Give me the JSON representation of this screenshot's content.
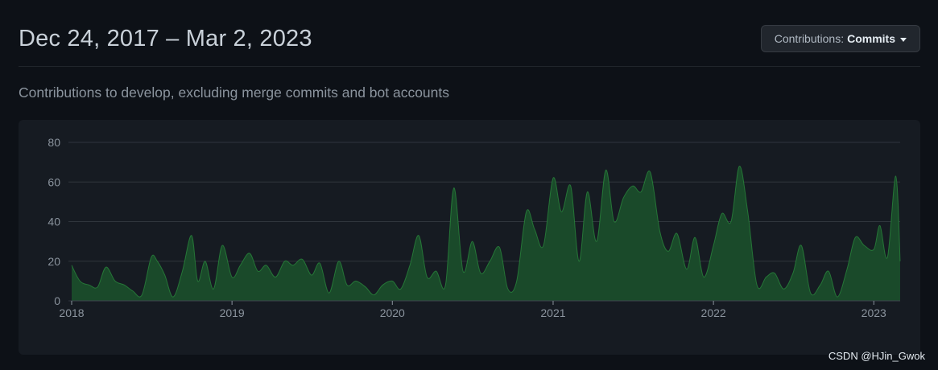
{
  "header": {
    "title": "Dec 24, 2017 – Mar 2, 2023",
    "dropdown_label": "Contributions:",
    "dropdown_value": "Commits"
  },
  "subtitle": "Contributions to develop, excluding merge commits and bot accounts",
  "watermark": "CSDN @HJin_Gwok",
  "colors": {
    "background": "#0d1117",
    "panel": "#161b22",
    "area_fill": "#1a4a2a",
    "area_stroke": "#2ea043",
    "grid": "#30363d",
    "axis_text": "#8b949e"
  },
  "chart_data": {
    "type": "area",
    "title": "",
    "xlabel": "",
    "ylabel": "",
    "ylim": [
      0,
      80
    ],
    "y_ticks": [
      0,
      20,
      40,
      60,
      80
    ],
    "x_ticks": [
      "2018",
      "2019",
      "2020",
      "2021",
      "2022",
      "2023"
    ],
    "xlim": [
      "2018-01-01",
      "2023-03-02"
    ],
    "grid": true,
    "series": [
      {
        "x": [
          "2018-01-01",
          "2018-01-20",
          "2018-02-10",
          "2018-03-01",
          "2018-03-20",
          "2018-04-10",
          "2018-05-01",
          "2018-05-20",
          "2018-06-10",
          "2018-07-01",
          "2018-07-15",
          "2018-08-01",
          "2018-08-20",
          "2018-09-10",
          "2018-10-01",
          "2018-10-15",
          "2018-11-01",
          "2018-11-20",
          "2018-12-10",
          "2019-01-01",
          "2019-01-20",
          "2019-02-10",
          "2019-03-01",
          "2019-03-20",
          "2019-04-10",
          "2019-05-01",
          "2019-05-20",
          "2019-06-10",
          "2019-07-01",
          "2019-07-20",
          "2019-08-10",
          "2019-09-01",
          "2019-09-20",
          "2019-10-10",
          "2019-11-01",
          "2019-11-20",
          "2019-12-10",
          "2020-01-01",
          "2020-01-20",
          "2020-02-10",
          "2020-03-01",
          "2020-03-20",
          "2020-04-10",
          "2020-05-01",
          "2020-05-20",
          "2020-06-10",
          "2020-07-01",
          "2020-07-20",
          "2020-08-10",
          "2020-09-01",
          "2020-09-20",
          "2020-10-10",
          "2020-11-01",
          "2020-11-20",
          "2020-12-10",
          "2021-01-01",
          "2021-01-20",
          "2021-02-10",
          "2021-03-01",
          "2021-03-20",
          "2021-04-10",
          "2021-05-01",
          "2021-05-20",
          "2021-06-10",
          "2021-07-01",
          "2021-07-20",
          "2021-08-10",
          "2021-09-01",
          "2021-09-20",
          "2021-10-10",
          "2021-11-01",
          "2021-11-20",
          "2021-12-10",
          "2022-01-01",
          "2022-01-20",
          "2022-02-10",
          "2022-03-01",
          "2022-03-20",
          "2022-04-10",
          "2022-05-01",
          "2022-05-20",
          "2022-06-10",
          "2022-07-01",
          "2022-07-20",
          "2022-08-10",
          "2022-09-01",
          "2022-09-20",
          "2022-10-10",
          "2022-11-01",
          "2022-11-20",
          "2022-12-10",
          "2023-01-01",
          "2023-01-15",
          "2023-02-01",
          "2023-02-20",
          "2023-03-02"
        ],
        "values": [
          18,
          10,
          8,
          7,
          17,
          10,
          8,
          5,
          3,
          22,
          20,
          13,
          2,
          15,
          33,
          10,
          20,
          6,
          28,
          12,
          18,
          24,
          15,
          18,
          12,
          20,
          18,
          21,
          13,
          19,
          4,
          20,
          8,
          10,
          7,
          3,
          8,
          10,
          6,
          18,
          33,
          12,
          15,
          8,
          57,
          15,
          30,
          14,
          20,
          27,
          6,
          10,
          45,
          36,
          28,
          62,
          45,
          58,
          20,
          55,
          30,
          66,
          40,
          52,
          58,
          55,
          65,
          35,
          25,
          34,
          16,
          32,
          12,
          28,
          44,
          40,
          68,
          45,
          8,
          12,
          14,
          6,
          14,
          28,
          4,
          8,
          15,
          2,
          16,
          32,
          28,
          26,
          38,
          22,
          63,
          20
        ]
      }
    ]
  }
}
